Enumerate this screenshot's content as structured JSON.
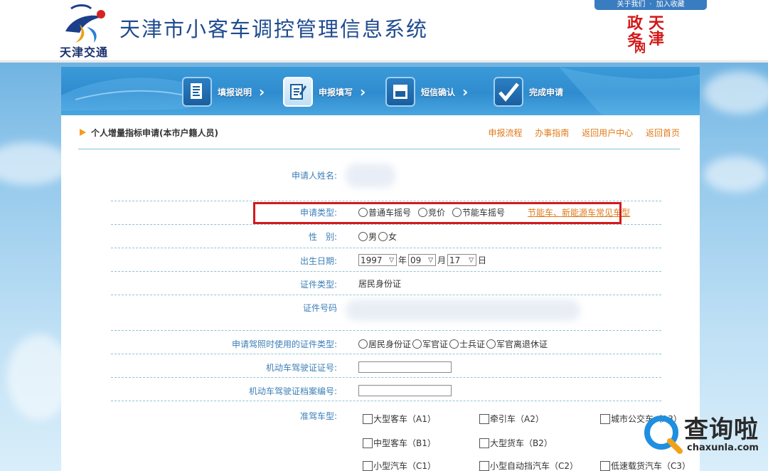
{
  "header": {
    "site_title": "天津市小客车调控管理信息系统",
    "logo_text": "天津交通",
    "top_links": [
      "关于我们",
      "加入收藏"
    ],
    "seal_chars": [
      "政",
      "天",
      "务",
      "津",
      "网"
    ]
  },
  "steps": [
    {
      "label": "填报说明",
      "icon": "document-icon"
    },
    {
      "label": "申报填写",
      "icon": "edit-icon"
    },
    {
      "label": "短信确认",
      "icon": "sms-icon"
    },
    {
      "label": "完成申请",
      "icon": "check-icon"
    }
  ],
  "section": {
    "title": "个人增量指标申请(本市户籍人员)",
    "links": [
      "申报流程",
      "办事指南",
      "返回用户中心",
      "返回首页"
    ]
  },
  "form": {
    "name_label": "申请人姓名:",
    "type_label": "申请类型:",
    "type_options": [
      "普通车摇号",
      "竞价",
      "节能车摇号"
    ],
    "type_note": "节能车、新能源车常见车型",
    "gender_label": "性　别:",
    "gender_options": [
      "男",
      "女"
    ],
    "birth_label": "出生日期:",
    "birth_year": "1997",
    "birth_year_unit": "年",
    "birth_month": "09",
    "birth_month_unit": "月",
    "birth_day": "17",
    "birth_day_unit": "日",
    "id_type_label": "证件类型:",
    "id_type_value": "居民身份证",
    "id_no_label": "证件号码",
    "license_id_type_label": "申请驾照时使用的证件类型:",
    "license_id_type_options": [
      "居民身份证",
      "军官证",
      "士兵证",
      "军官离退休证"
    ],
    "license_no_label": "机动车驾驶证证号:",
    "license_file_label": "机动车驾驶证档案编号:",
    "vehicle_class_label": "准驾车型:",
    "vehicle_classes": [
      [
        "大型客车（A1）",
        "牵引车（A2）",
        "城市公交车（A3）"
      ],
      [
        "中型客车（B1）",
        "大型货车（B2）"
      ],
      [
        "小型汽车（C1）",
        "小型自动挡汽车（C2）",
        "低速载货汽车（C3）"
      ]
    ]
  },
  "watermark": {
    "brand": "查询啦",
    "domain": "chaxunla.com"
  }
}
